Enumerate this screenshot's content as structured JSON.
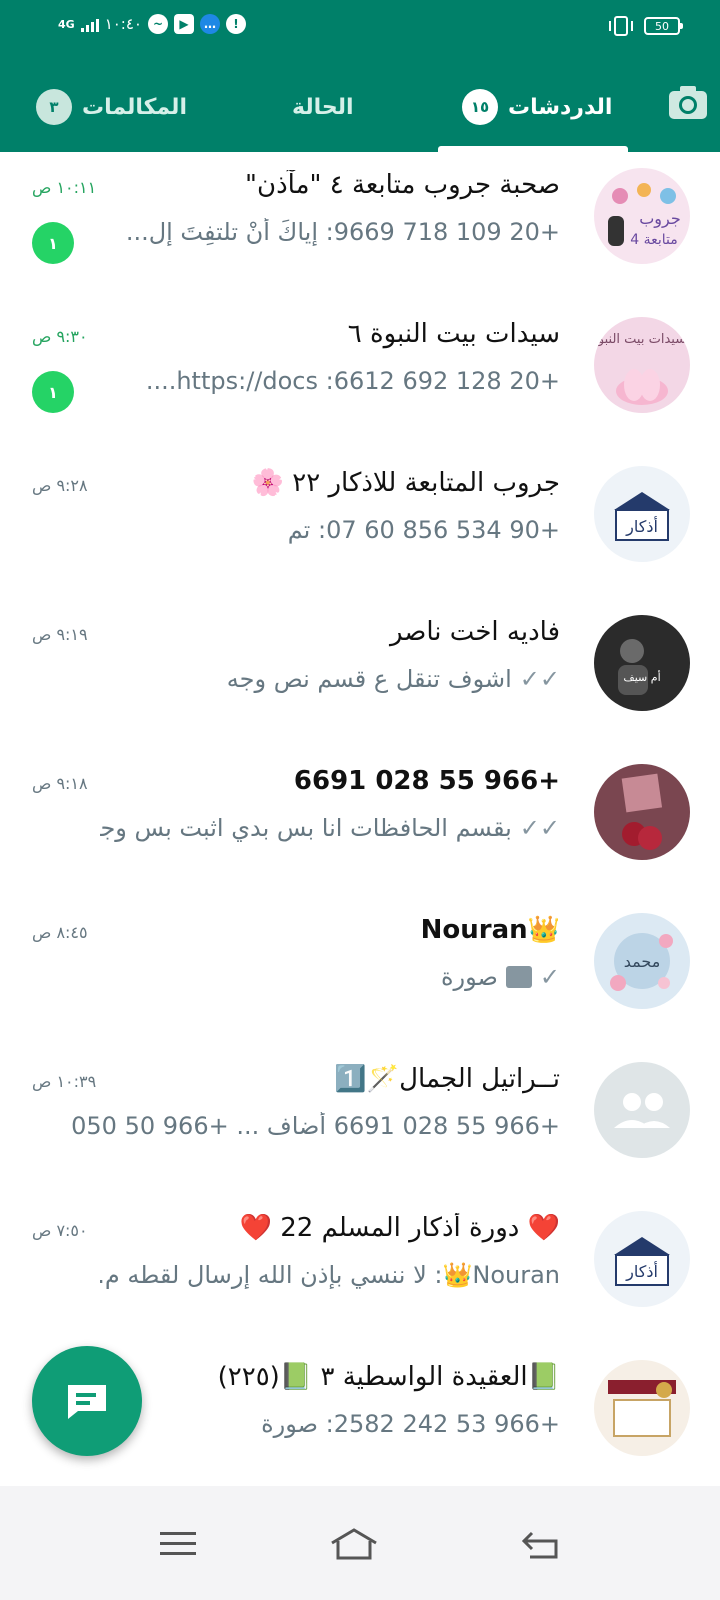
{
  "status_bar": {
    "network": "4G",
    "time": "١٠:٤٠",
    "battery": "50"
  },
  "tabs": [
    {
      "label": "الدردشات",
      "badge": "١٥",
      "active": true
    },
    {
      "label": "الحالة",
      "badge": "",
      "active": false
    },
    {
      "label": "المكالمات",
      "badge": "٣",
      "active": false
    }
  ],
  "chats": [
    {
      "name": "صحبة جروب متابعة ٤ \"مآذن\"",
      "preview": "+20 109 718 9669: إياكَ أنْ تلتفِتَ إل...",
      "time": "١٠:١١ ص",
      "unread": "١"
    },
    {
      "name": "سيدات بيت النبوة ٦",
      "preview": "+20 128 692 6612: https://docs.... ",
      "time": "٩:٣٠ ص",
      "unread": "١"
    },
    {
      "name": "جروب المتابعة للاذكار ٢٢",
      "name_emoji": "🌸",
      "preview": "+90 534 856 60 07: تم",
      "time": "٩:٢٨ ص",
      "unread": ""
    },
    {
      "name": "فاديه اخت ناصر",
      "preview": "اشوف تنقل ع قسم نص وجه",
      "time": "٩:١٩ ص",
      "unread": ""
    },
    {
      "name": "+966 55 028 6691",
      "preview": "بقسم الحافظات انا بس بدي اثبت بس وجه",
      "time": "٩:١٨ ص",
      "unread": ""
    },
    {
      "name": "Nouran",
      "name_emoji": "👑",
      "preview": "صورة",
      "time": "٨:٤٥ ص",
      "unread": ""
    },
    {
      "name": "تــراتيل الجمال",
      "name_emoji": "🪄1️⃣",
      "preview": "+966 55 028 6691 أضاف ... +966 50 050",
      "time": "١٠:٣٩ ص",
      "unread": ""
    },
    {
      "name": "دورة أذكار المسلم 22",
      "name_emoji": "❤️",
      "preview": "Nouran👑: لا ننسي بإذن الله إرسال لقطه م...",
      "time": "٧:٥٠ ص",
      "unread": ""
    },
    {
      "name": "العقيدة الواسطية ٣",
      "name_emoji": "📗",
      "name_suffix": "(٢٢٥)",
      "preview": "+966 53 242 2582: صورة",
      "time": "",
      "unread": ""
    }
  ],
  "colors": {
    "primary": "#008069",
    "unread_green": "#25d366",
    "fab": "#0f9d76"
  }
}
